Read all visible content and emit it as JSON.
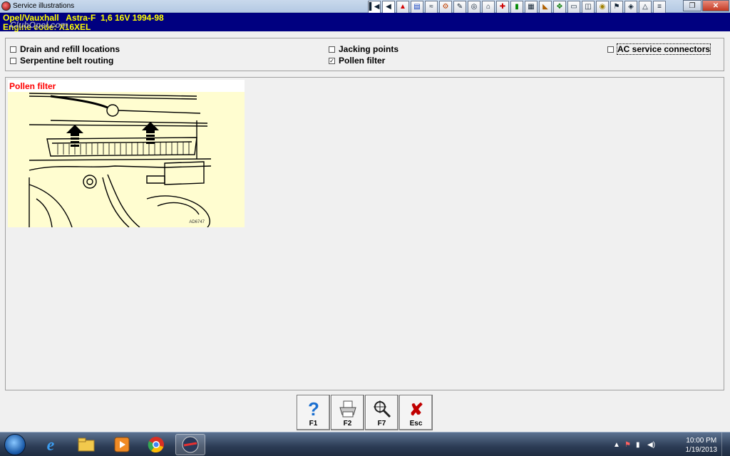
{
  "window": {
    "title": "Service illustrations",
    "toolbar_icons": [
      "first-icon",
      "previous-icon",
      "warning-icon",
      "info-icon",
      "wiring-icon",
      "engine-icon",
      "wrench-icon",
      "timing-icon",
      "diagnostics-icon",
      "tools-icon",
      "battery-icon",
      "chart-icon",
      "seat-icon",
      "gearbox-icon",
      "lift-icon",
      "car-icon",
      "oil-icon",
      "service-icon",
      "camera-icon",
      "sensor-icon",
      "notes-icon"
    ]
  },
  "vehicle": {
    "make": "Opel/Vauxhall",
    "model": "Astra-F",
    "variant": "1,6 16V 1994-98",
    "engine_label": "Engine code:",
    "engine_code": "X16XEL",
    "watermark": "ClubOpel.com"
  },
  "options": {
    "drain_refill": {
      "label": "Drain and refill locations",
      "checked": false
    },
    "serpentine": {
      "label": "Serpentine belt routing",
      "checked": false
    },
    "jacking": {
      "label": "Jacking points",
      "checked": false
    },
    "pollen": {
      "label": "Pollen filter",
      "checked": true
    },
    "ac": {
      "label": "AC service connectors",
      "checked": false
    }
  },
  "illustration": {
    "caption": "Pollen filter",
    "ref_code": "AD6747"
  },
  "fkeys": {
    "f1": {
      "label": "F1",
      "icon": "help-icon"
    },
    "f2": {
      "label": "F2",
      "icon": "print-icon"
    },
    "f7": {
      "label": "F7",
      "icon": "zoom-icon"
    },
    "esc": {
      "label": "Esc",
      "icon": "close-icon"
    }
  },
  "taskbar": {
    "apps": [
      "internet-explorer-icon",
      "file-explorer-icon",
      "media-player-icon",
      "chrome-icon",
      "opel-app-icon"
    ],
    "time": "10:00 PM",
    "date": "1/19/2013"
  },
  "colors": {
    "vehicle_bar_bg": "#000080",
    "vehicle_text": "#ffff00",
    "caption_red": "#ff0000",
    "illustration_bg": "#fffdd0"
  }
}
